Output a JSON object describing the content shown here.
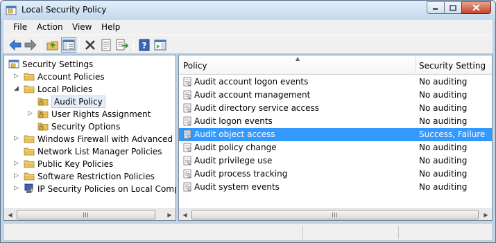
{
  "window": {
    "title": "Local Security Policy",
    "controls": {
      "minimize": "minimize-icon",
      "maximize": "maximize-icon",
      "close": "close-icon"
    }
  },
  "menu": {
    "items": [
      "File",
      "Action",
      "View",
      "Help"
    ]
  },
  "toolbar": {
    "icons": [
      "back-arrow-icon",
      "forward-arrow-icon",
      "up-folder-icon",
      "show-hide-tree-icon",
      "delete-icon",
      "properties-icon",
      "export-list-icon",
      "help-icon",
      "action-pane-icon"
    ]
  },
  "tree": {
    "root": "Security Settings",
    "items": [
      {
        "label": "Account Policies",
        "level": 1,
        "expander": "collapsed"
      },
      {
        "label": "Local Policies",
        "level": 1,
        "expander": "expanded"
      },
      {
        "label": "Audit Policy",
        "level": 2,
        "expander": "none",
        "selected": true
      },
      {
        "label": "User Rights Assignment",
        "level": 2,
        "expander": "collapsed"
      },
      {
        "label": "Security Options",
        "level": 2,
        "expander": "none"
      },
      {
        "label": "Windows Firewall with Advanced Secu",
        "level": 1,
        "expander": "collapsed"
      },
      {
        "label": "Network List Manager Policies",
        "level": 1,
        "expander": "none"
      },
      {
        "label": "Public Key Policies",
        "level": 1,
        "expander": "collapsed"
      },
      {
        "label": "Software Restriction Policies",
        "level": 1,
        "expander": "collapsed"
      },
      {
        "label": "IP Security Policies on Local Compute",
        "level": 1,
        "expander": "collapsed"
      }
    ]
  },
  "list": {
    "columns": [
      "Policy",
      "Security Setting"
    ],
    "rows": [
      {
        "policy": "Audit account logon events",
        "setting": "No auditing"
      },
      {
        "policy": "Audit account management",
        "setting": "No auditing"
      },
      {
        "policy": "Audit directory service access",
        "setting": "No auditing"
      },
      {
        "policy": "Audit logon events",
        "setting": "No auditing"
      },
      {
        "policy": "Audit object access",
        "setting": "Success, Failure",
        "selected": true
      },
      {
        "policy": "Audit policy change",
        "setting": "No auditing"
      },
      {
        "policy": "Audit privilege use",
        "setting": "No auditing"
      },
      {
        "policy": "Audit process tracking",
        "setting": "No auditing"
      },
      {
        "policy": "Audit system events",
        "setting": "No auditing"
      }
    ]
  },
  "colors": {
    "selection": "#3399ff",
    "frame": "#bcd5ea",
    "folder": "#e8c15a"
  }
}
